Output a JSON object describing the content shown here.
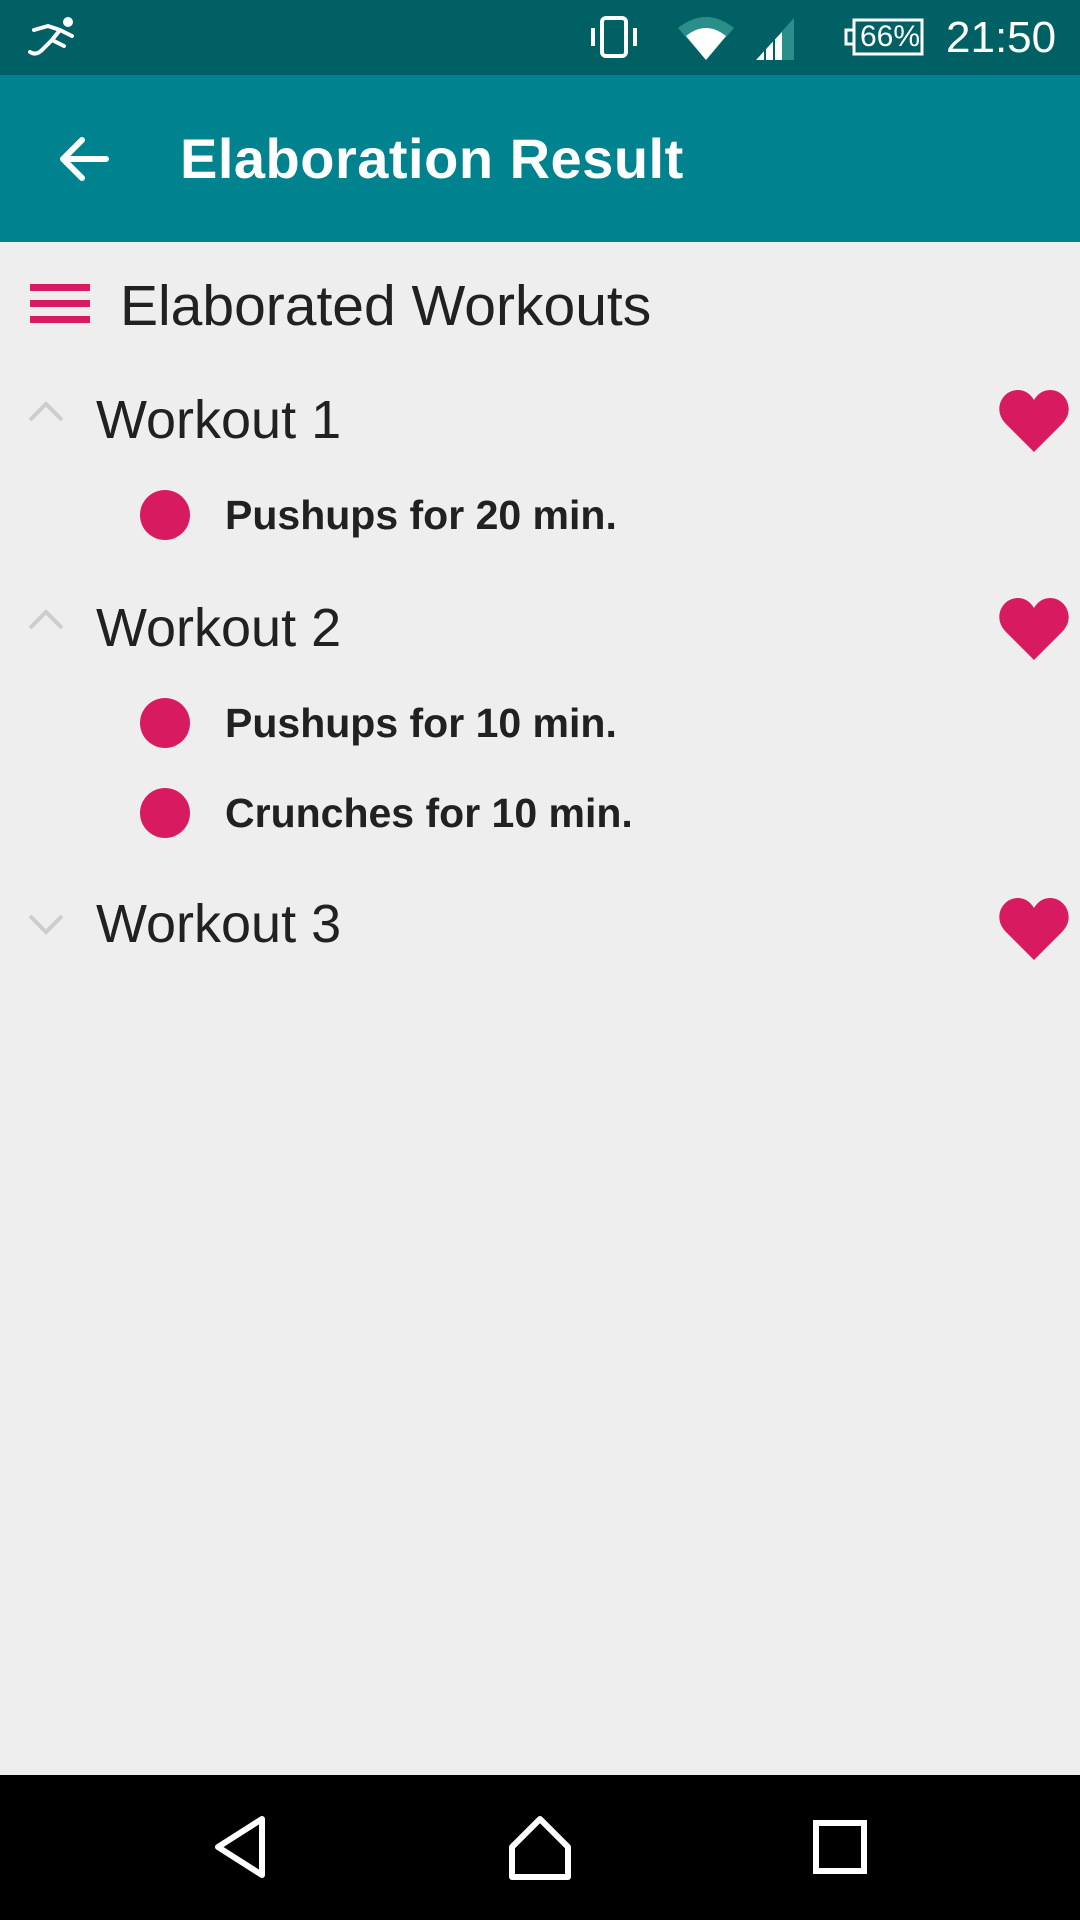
{
  "status_bar": {
    "battery": "66%",
    "time": "21:50",
    "icons": [
      "running-app-icon",
      "vibrate-icon",
      "wifi-icon",
      "cell-signal-icon",
      "battery-icon"
    ]
  },
  "app_bar": {
    "title": "Elaboration Result",
    "back_icon": "arrow-left-icon"
  },
  "section": {
    "title": "Elaborated Workouts",
    "icon": "menu-lines-icon",
    "accent_color": "#d81b60"
  },
  "workouts": [
    {
      "title": "Workout 1",
      "expanded": true,
      "favorite": true,
      "exercises": [
        "Pushups for 20 min."
      ]
    },
    {
      "title": "Workout 2",
      "expanded": true,
      "favorite": true,
      "exercises": [
        "Pushups for 10 min.",
        "Crunches for 10 min."
      ]
    },
    {
      "title": "Workout 3",
      "expanded": false,
      "favorite": true,
      "exercises": []
    }
  ],
  "nav_bar": {
    "buttons": [
      "back-triangle-icon",
      "home-icon",
      "recents-square-icon"
    ]
  },
  "colors": {
    "status_bar": "#006064",
    "app_bar": "#00838f",
    "background": "#eeeeee",
    "accent": "#d81b60"
  }
}
